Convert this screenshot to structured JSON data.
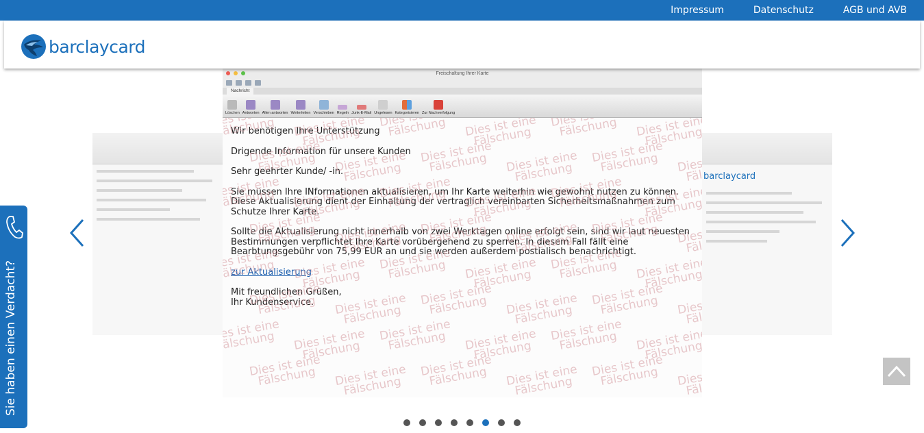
{
  "topnav": {
    "items": [
      "Impressum",
      "Datenschutz",
      "AGB und AVB"
    ]
  },
  "logo": {
    "text": "barclaycard"
  },
  "colors": {
    "brand": "#1c70bb",
    "pager_inactive": "#555555",
    "totop": "#c4c4c4"
  },
  "mail": {
    "window_title": "Freischaltung Ihrer Karte",
    "tab": "Nachricht",
    "ribbon": [
      "Löschen",
      "Antworten",
      "Allen antworten",
      "Weiterleiten",
      "Verschieben",
      "Regeln",
      "Junk-E-Mail",
      "Ungelesen",
      "Kategorisieren",
      "Zur Nachverfolgung"
    ],
    "subject": "Wir benötigen Ihre Unterstützung",
    "line1": "Drigende Information für unsere Kunden",
    "salutation": "Sehr geehrter Kunde/ -in.",
    "para1": "Sie müssen Ihre INformationen aktualisieren, um Ihr Karte weiterhin wie gewohnt nutzen zu können. Diese Aktualisierung dient der Einhaltung der vertraglich vereinbarten Sicherheitsmaßnahmen zum Schutze Ihrer Karte.",
    "para2": "Sollte die Aktualisierung nicht innerhalb von zwei Werktagen online erfolgt sein, sind wir laut neuesten Bestimmungen verpflichtet Ihre Karte vorübergehend zu sperren. In diesem Fall fällt eine Bearbtungsgebühr von 75,99 EUR an und sie werden außerdem postialisch benachrichtigt.",
    "link": "zur Aktualisierung",
    "closing1": "Mit freundlichen Grüßen,",
    "closing2": "Ihr Kundenservice."
  },
  "watermark": {
    "line1": "Dies ist eine",
    "line2": "Fälschung"
  },
  "side_right_logo": "barclaycard",
  "carousel": {
    "total": 8,
    "active_index": 5
  },
  "suspect_tab": {
    "label": "Sie haben einen Verdacht?"
  },
  "icons": {
    "prev": "chevron-left-icon",
    "next": "chevron-right-icon",
    "phone": "phone-icon",
    "top": "chevron-up-icon"
  }
}
